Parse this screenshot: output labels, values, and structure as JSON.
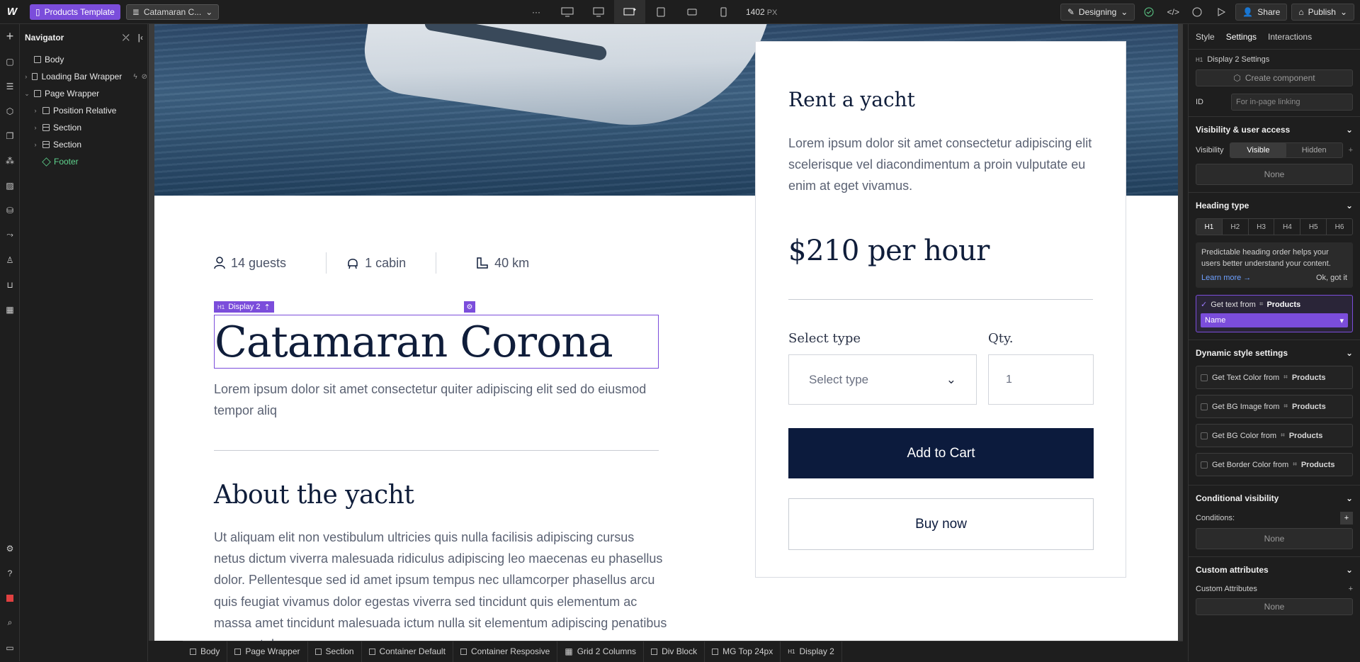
{
  "topbar": {
    "page_label": "Products Template",
    "collection_label": "Catamaran C...",
    "more": "···",
    "width_value": "1402",
    "width_unit": "PX",
    "mode": "Designing",
    "share": "Share",
    "publish": "Publish"
  },
  "navigator": {
    "title": "Navigator",
    "items": [
      {
        "label": "Body"
      },
      {
        "label": "Loading Bar Wrapper"
      },
      {
        "label": "Page Wrapper"
      },
      {
        "label": "Position Relative"
      },
      {
        "label": "Section"
      },
      {
        "label": "Section"
      },
      {
        "label": "Footer"
      }
    ]
  },
  "canvas": {
    "stats": [
      {
        "icon": "person-icon",
        "label": "14 guests"
      },
      {
        "icon": "seat-icon",
        "label": "1 cabin"
      },
      {
        "icon": "distance-icon",
        "label": "40 km"
      }
    ],
    "selection_tag": "Display 2",
    "selection_level": "H1",
    "title": "Catamaran Corona",
    "lead": "Lorem ipsum dolor sit amet consectetur quiter adipiscing elit sed do eiusmod tempor aliq",
    "about_heading": "About the yacht",
    "about_text": "Ut aliquam elit non vestibulum ultricies quis nulla facilisis adipiscing cursus netus dictum viverra malesuada ridiculus adipiscing leo maecenas eu phasellus dolor. Pellentesque sed id amet ipsum tempus nec ullamcorper phasellus arcu quis feugiat vivamus dolor egestas viverra sed tincidunt quis elementum ac massa amet tincidunt malesuada ictum nulla sit elementum adipiscing penatibus praesent du.",
    "card": {
      "title": "Rent a yacht",
      "description": "Lorem ipsum dolor sit amet consectetur adipiscing elit scelerisque vel diacondimentum a proin vulputate eu enim at eget vivamus.",
      "price": "$210 per hour",
      "select_label": "Select type",
      "select_placeholder": "Select type",
      "qty_label": "Qty.",
      "qty_value": "1",
      "add_to_cart": "Add to Cart",
      "buy_now": "Buy now"
    }
  },
  "breadcrumb": [
    "Body",
    "Page Wrapper",
    "Section",
    "Container Default",
    "Container Resposive",
    "Grid 2 Columns",
    "Div Block",
    "MG Top 24px",
    "Display 2"
  ],
  "right_panel": {
    "tabs": [
      "Style",
      "Settings",
      "Interactions"
    ],
    "active_tab": "Settings",
    "element_tag": "H1",
    "element_settings": "Display 2 Settings",
    "create_component": "Create component",
    "id_label": "ID",
    "id_placeholder": "For in-page linking",
    "visibility_section": "Visibility & user access",
    "visibility_label": "Visibility",
    "visible": "Visible",
    "hidden": "Hidden",
    "visibility_none": "None",
    "heading_type": "Heading type",
    "headings": [
      "H1",
      "H2",
      "H3",
      "H4",
      "H5",
      "H6"
    ],
    "note": "Predictable heading order helps your users better understand your content.",
    "learn_more": "Learn more →",
    "ok_got_it": "Ok, got it",
    "get_text_from": "Get text from",
    "products": "Products",
    "name_field": "Name",
    "dynamic_style": "Dynamic style settings",
    "dynamic_items": [
      "Get Text Color from",
      "Get BG Image from",
      "Get BG Color from",
      "Get Border Color from"
    ],
    "conditional": "Conditional visibility",
    "conditions_label": "Conditions:",
    "conditions_none": "None",
    "custom_attributes": "Custom attributes",
    "custom_attributes_label": "Custom Attributes",
    "custom_none": "None"
  },
  "colors": {
    "accent": "#7b4ddb",
    "navy": "#0c1b3d",
    "footer_green": "#5fd38d"
  }
}
